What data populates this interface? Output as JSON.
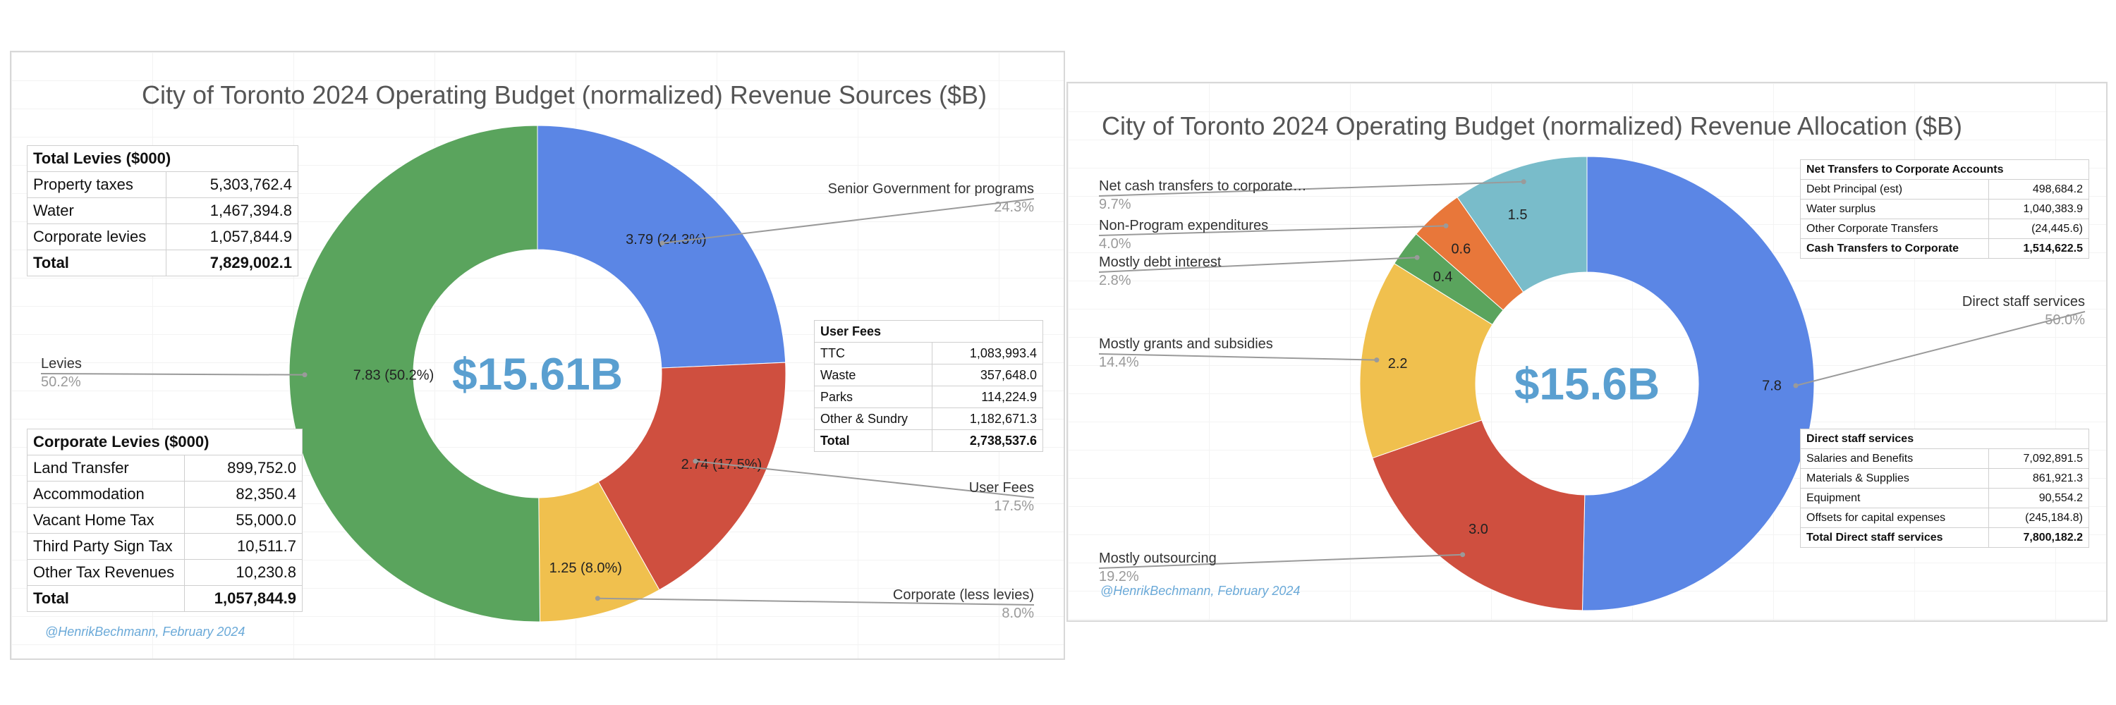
{
  "left": {
    "title": "City of Toronto 2024 Operating Budget (normalized) Revenue Sources ($B)",
    "credit": "@HenrikBechmann, February 2024",
    "tables": {
      "total_levies": {
        "header": "Total Levies ($000)",
        "rows": [
          {
            "label": "Property taxes",
            "value": "5,303,762.4"
          },
          {
            "label": "Water",
            "value": "1,467,394.8"
          },
          {
            "label": "Corporate levies",
            "value": "1,057,844.9"
          }
        ],
        "total": {
          "label": "Total",
          "value": "7,829,002.1"
        }
      },
      "corporate_levies": {
        "header": "Corporate Levies ($000)",
        "rows": [
          {
            "label": "Land Transfer",
            "value": "899,752.0"
          },
          {
            "label": "Accommodation",
            "value": "82,350.4"
          },
          {
            "label": "Vacant Home Tax",
            "value": "55,000.0"
          },
          {
            "label": "Third Party Sign Tax",
            "value": "10,511.7"
          },
          {
            "label": "Other Tax Revenues",
            "value": "10,230.8"
          }
        ],
        "total": {
          "label": "Total",
          "value": "1,057,844.9"
        }
      },
      "user_fees": {
        "header": "User Fees",
        "rows": [
          {
            "label": "TTC",
            "value": "1,083,993.4"
          },
          {
            "label": "Waste",
            "value": "357,648.0"
          },
          {
            "label": "Parks",
            "value": "114,224.9"
          },
          {
            "label": "Other & Sundry",
            "value": "1,182,671.3"
          }
        ],
        "total": {
          "label": "Total",
          "value": "2,738,537.6"
        }
      }
    }
  },
  "right": {
    "title": "City of Toronto 2024 Operating Budget (normalized) Revenue Allocation ($B)",
    "credit": "@HenrikBechmann, February 2024",
    "tables": {
      "net_transfers": {
        "header": "Net Transfers to Corporate Accounts",
        "rows": [
          {
            "label": "Debt Principal (est)",
            "value": "498,684.2"
          },
          {
            "label": "Water surplus",
            "value": "1,040,383.9"
          },
          {
            "label": "Other Corporate Transfers",
            "value": "(24,445.6)"
          }
        ],
        "total": {
          "label": "Cash Transfers to Corporate",
          "value": "1,514,622.5"
        }
      },
      "direct_staff": {
        "header": "Direct staff services",
        "rows": [
          {
            "label": "Salaries and Benefits",
            "value": "7,092,891.5"
          },
          {
            "label": "Materials & Supplies",
            "value": "861,921.3"
          },
          {
            "label": "Equipment",
            "value": "90,554.2"
          },
          {
            "label": "Offsets for capital expenses",
            "value": "(245,184.8)"
          }
        ],
        "total": {
          "label": "Total Direct staff services",
          "value": "7,800,182.2"
        }
      }
    }
  },
  "chart_data": [
    {
      "type": "pie",
      "donut": true,
      "title": "City of Toronto 2024 Operating Budget (normalized) Revenue Sources ($B)",
      "center_label": "$15.61B",
      "start_angle_deg": 0,
      "slices": [
        {
          "name": "Senior Government for programs",
          "value": 3.79,
          "percent": "24.3%",
          "label": "3.79 (24.3%)",
          "color": "#5b86e5",
          "label_color": "#222"
        },
        {
          "name": "User Fees",
          "value": 2.74,
          "percent": "17.5%",
          "label": "2.74 (17.5%)",
          "color": "#cf4f3f",
          "label_color": "#222"
        },
        {
          "name": "Corporate (less levies)",
          "value": 1.25,
          "percent": "8.0%",
          "label": "1.25 (8.0%)",
          "color": "#f0c04e",
          "label_color": "#222"
        },
        {
          "name": "Levies",
          "value": 7.83,
          "percent": "50.2%",
          "label": "7.83 (50.2%)",
          "color": "#5aa45d",
          "label_color": "#222"
        }
      ]
    },
    {
      "type": "pie",
      "donut": true,
      "title": "City of Toronto 2024 Operating Budget (normalized) Revenue Allocation ($B)",
      "center_label": "$15.6B",
      "start_angle_deg": 0,
      "slices": [
        {
          "name": "Direct staff services",
          "value": 7.8,
          "percent": "50.0%",
          "label": "7.8",
          "color": "#5b86e5",
          "label_color": "#222"
        },
        {
          "name": "Mostly outsourcing",
          "value": 3.0,
          "percent": "19.2%",
          "label": "3.0",
          "color": "#cf4f3f",
          "label_color": "#222"
        },
        {
          "name": "Mostly grants and subsidies",
          "value": 2.2,
          "percent": "14.4%",
          "label": "2.2",
          "color": "#f0c04e",
          "label_color": "#222"
        },
        {
          "name": "Mostly debt interest",
          "value": 0.4,
          "percent": "2.8%",
          "label": "0.4",
          "color": "#5aa45d",
          "label_color": "#222"
        },
        {
          "name": "Non-Program expenditures",
          "value": 0.6,
          "percent": "4.0%",
          "label": "0.6",
          "color": "#e8773a",
          "label_color": "#222"
        },
        {
          "name": "Net cash transfers to corporate…",
          "value": 1.5,
          "percent": "9.7%",
          "label": "1.5",
          "color": "#79bcca",
          "label_color": "#222"
        }
      ]
    }
  ]
}
